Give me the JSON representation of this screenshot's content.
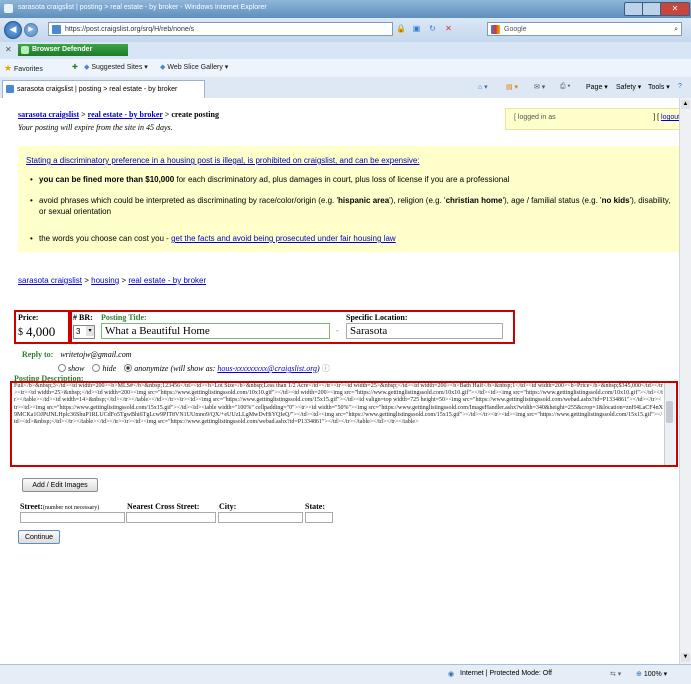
{
  "window": {
    "title": "sarasota craigslist | posting > real estate - by broker - Windows Internet Explorer"
  },
  "address_bar": {
    "url": "https://post.craigslist.org/srq/H/reb/none/s",
    "search_placeholder": "Google"
  },
  "toolbar": {
    "browser_defender_label": "Browser Defender"
  },
  "favorites_bar": {
    "favorites_label": "Favorites",
    "suggested_sites": "Suggested Sites ▾",
    "web_slice_gallery": "Web Slice Gallery ▾"
  },
  "tab": {
    "title": "sarasota craigslist | posting > real estate - by broker"
  },
  "command_bar": {
    "page": "Page ▾",
    "safety": "Safety ▾",
    "tools": "Tools ▾"
  },
  "header": {
    "site": "sarasota craigslist",
    "sep1": " > ",
    "category": "real estate - by broker",
    "sep2": " > create posting",
    "expire_note": "Your posting will expire from the site in 45 days.",
    "logged_in_as": "[ logged in as",
    "logout_open": "] [",
    "logout": "logout",
    "logout_close": "]"
  },
  "fair_housing": {
    "heading": "Stating a discriminatory preference in a housing post is illegal, is prohibited on craigslist, and can be expensive:",
    "b1_bold": "you can be fined more than $10,000",
    "b1_rest": " for each discriminatory ad, plus damages in court, plus loss of license if you are a professional",
    "b2_a": "avoid phrases which could be interpreted as discriminating by race/color/origin (e.g. '",
    "b2_b": "hispanic area",
    "b2_c": "'), religion (e.g. '",
    "b2_d": "christian home",
    "b2_e": "'), age / familial status (e.g. '",
    "b2_f": "no kids",
    "b2_g": "'), disability, or sexual orientation",
    "b3_text": "the words you choose can cost you - ",
    "b3_link": "get the facts and avoid being prosecuted under fair housing law"
  },
  "breadcrumb2": {
    "site": "sarasota craigslist",
    "sep1": " > ",
    "housing": "housing",
    "sep2": " > ",
    "category": "real estate - by broker"
  },
  "form": {
    "price_label": "Price:",
    "price_symbol": "$",
    "price_value": "4,000",
    "br_label": "# BR:",
    "br_value": "3",
    "title_label": "Posting Title:",
    "title_value": "What a Beautiful Home",
    "dash": "-",
    "location_label": "Specific Location:",
    "location_value": "Sarasota",
    "reply_label": "Reply to:",
    "reply_email": "writetojw@gmail.com",
    "reply_show": "show",
    "reply_hide": "hide",
    "reply_anon": "anonymize (will show as:",
    "reply_anon_email": "hous-xxxxxxxxx@craigslist.org",
    "reply_anon_close": ")",
    "desc_label": "Posting Description:",
    "description": "Full</b>&nbsp;3</td><td width=200><b>MLS#</b>&nbsp;123456</td><td><b>Lot Size</b>&nbsp;Less than 1/2 Acre</td></tr><tr><td width=25>&nbsp;</td><td width=200><b>Bath Half</b>&nbsp;1</td><td width=200><b>Price</b>&nbsp;$345,000</td></tr><tr><td width=25>&nbsp;</td><td width=200><img src=\"https://www.gettinglistingssold.com/10x10.gif\"></td><td width=200><img src=\"https://www.gettinglistingssold.com/10x10.gif\"></td><td><img src=\"https://www.gettinglistingssold.com/10x10.gif\"></td></tr></table></td><td width=14>&nbsp;</td></tr></table></td></tr><tr><td><img src=\"https://www.gettinglistingssold.com/15x15.gif\"></td><td valign=top width=725 height=50><img src=\"https://www.gettinglistingssold.com/webad.ashx?id=P1334861\"></td></tr><tr><td><img src=\"https://www.gettinglistingssold.com/15x15.gif\"></td><td><table width=\"100%\" cellpadding=\"0\"><tr><td width=\"50%\"><img src=\"https://www.gettinglistingssold.com/ImageHandler.ashx?width=340&height=255&crop=1&location=znH4LaCF4nX9MCKa1OJPtJNLHplc36ShuP1RLUCdFo5TgwBhi6TgLcw9PIT8VN1UUmno9/QX/+eUUzLLgMwDvHiYQIeQ/\"></td><td><img src=\"https://www.gettinglistingssold.com/15x15.gif\"></td></tr><tr><td><img src=\"https://www.gettinglistingssold.com/15x15.gif\"></td><td>&nbsp;</td></tr></table></td></tr><tr><td><img src=\"https://www.gettinglistingssold.com/webad.ashx?id=P1334861\"></td></tr></table></td></tr></table>",
    "add_images_button": "Add / Edit Images",
    "street_label": "Street:",
    "street_note": "(number not necessary)",
    "cross_label": "Nearest Cross Street:",
    "city_label": "City:",
    "state_label": "State:",
    "continue_button": "Continue"
  },
  "status_bar": {
    "zone": "Internet | Protected Mode: Off",
    "zoom": "100%"
  },
  "colors": {
    "link": "#0000cc",
    "highlight_box": "#ffffcc",
    "annotation_red": "#cc0000",
    "label_green": "#2e7d32",
    "title_label_green": "#2e7d32"
  }
}
